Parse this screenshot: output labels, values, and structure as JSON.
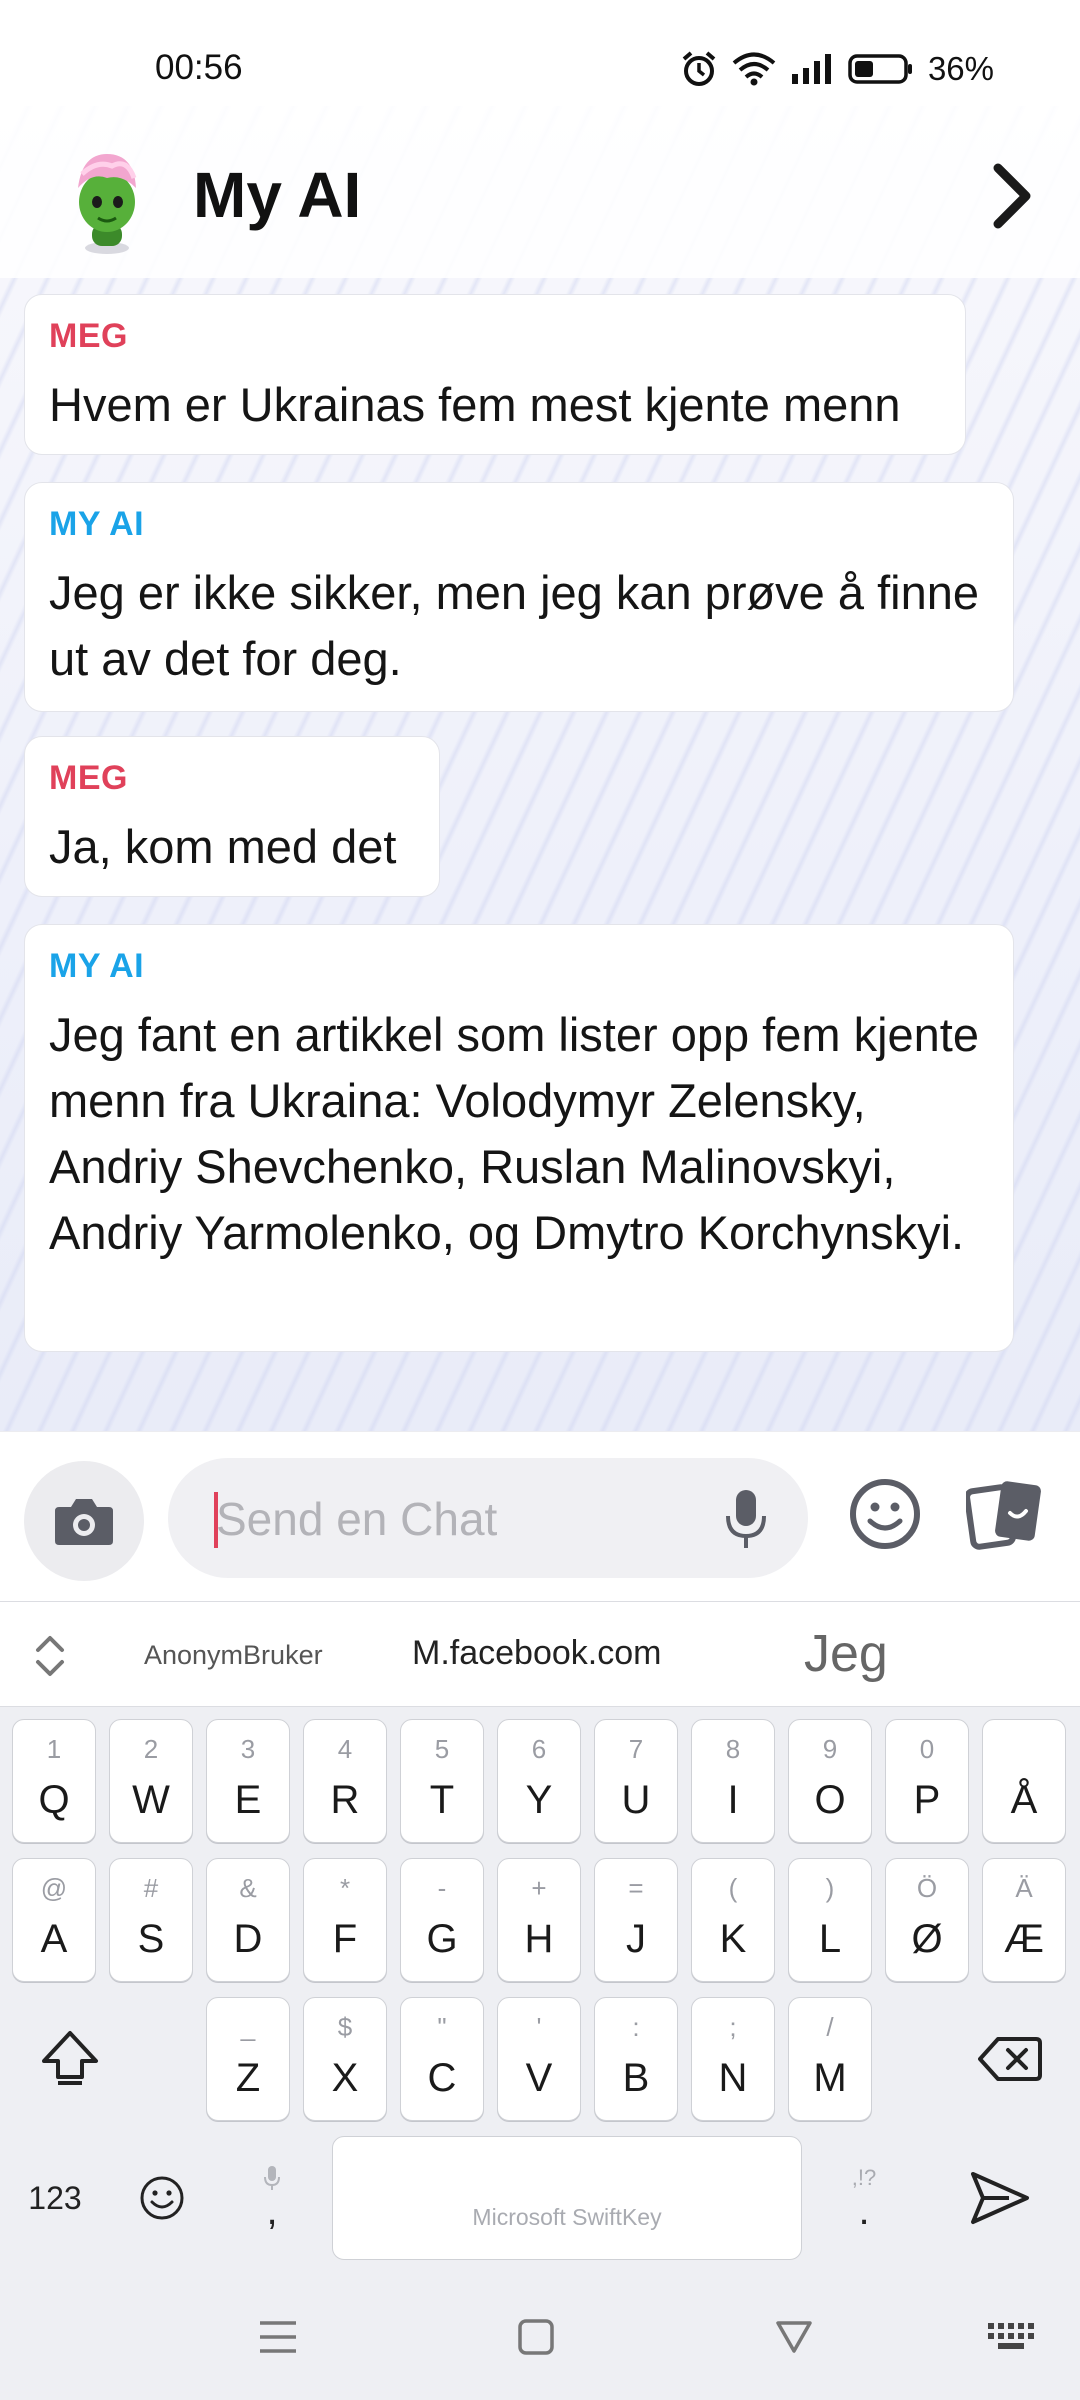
{
  "status_bar": {
    "time": "00:56",
    "battery_percent": "36%",
    "icons": [
      "alarm-icon",
      "wifi-icon",
      "signal-icon",
      "battery-icon"
    ]
  },
  "header": {
    "title": "My AI"
  },
  "messages": [
    {
      "sender": "MEG",
      "role": "me",
      "text": "Hvem er Ukrainas fem mest kjente menn"
    },
    {
      "sender": "MY AI",
      "role": "ai",
      "text": "Jeg er ikke sikker, men jeg kan prøve å finne ut av det for deg."
    },
    {
      "sender": "MEG",
      "role": "me",
      "text": "Ja, kom med det"
    },
    {
      "sender": "MY AI",
      "role": "ai",
      "text": "Jeg fant en artikkel som lister opp fem kjente menn fra Ukraina: Volodymyr Zelensky, Andriy Shevchenko, Ruslan Malinovskyi, Andriy Yarmolenko, og Dmytro Korchynskyi."
    }
  ],
  "input": {
    "placeholder": "Send en Chat",
    "value": ""
  },
  "keyboard": {
    "suggestions": [
      "AnonymBruker",
      "M.facebook.com",
      "Jeg"
    ],
    "row1": [
      {
        "sub": "1",
        "main": "Q"
      },
      {
        "sub": "2",
        "main": "W"
      },
      {
        "sub": "3",
        "main": "E"
      },
      {
        "sub": "4",
        "main": "R"
      },
      {
        "sub": "5",
        "main": "T"
      },
      {
        "sub": "6",
        "main": "Y"
      },
      {
        "sub": "7",
        "main": "U"
      },
      {
        "sub": "8",
        "main": "I"
      },
      {
        "sub": "9",
        "main": "O"
      },
      {
        "sub": "0",
        "main": "P"
      },
      {
        "sub": "",
        "main": "Å"
      }
    ],
    "row2": [
      {
        "sub": "@",
        "main": "A"
      },
      {
        "sub": "#",
        "main": "S"
      },
      {
        "sub": "&",
        "main": "D"
      },
      {
        "sub": "*",
        "main": "F"
      },
      {
        "sub": "-",
        "main": "G"
      },
      {
        "sub": "+",
        "main": "H"
      },
      {
        "sub": "=",
        "main": "J"
      },
      {
        "sub": "(",
        "main": "K"
      },
      {
        "sub": ")",
        "main": "L"
      },
      {
        "sub": "Ö",
        "main": "Ø"
      },
      {
        "sub": "Ä",
        "main": "Æ"
      }
    ],
    "row3": [
      {
        "sub": "_",
        "main": "Z"
      },
      {
        "sub": "$",
        "main": "X"
      },
      {
        "sub": "\"",
        "main": "C"
      },
      {
        "sub": "'",
        "main": "V"
      },
      {
        "sub": ":",
        "main": "B"
      },
      {
        "sub": ";",
        "main": "N"
      },
      {
        "sub": "/",
        "main": "M"
      }
    ],
    "numbers_label": "123",
    "comma": ",",
    "period": ".",
    "period_sub": ",!?",
    "space_label": "Microsoft SwiftKey"
  },
  "colors": {
    "me_accent": "#e0415a",
    "ai_accent": "#1aa3e8"
  }
}
